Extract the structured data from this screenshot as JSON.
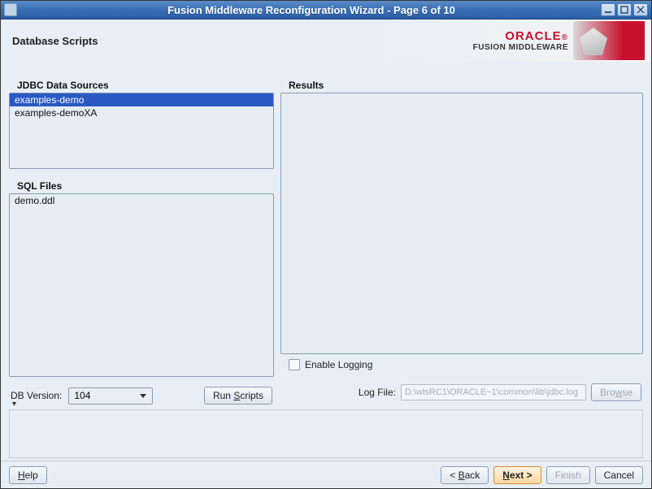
{
  "window": {
    "title": "Fusion Middleware Reconfiguration Wizard - Page 6 of 10"
  },
  "header": {
    "title": "Database Scripts",
    "brand_main": "ORACLE",
    "brand_sub": "FUSION MIDDLEWARE"
  },
  "left": {
    "ds_label": "JDBC Data Sources",
    "ds_items": [
      "examples-demo",
      "examples-demoXA"
    ],
    "ds_selected_index": 0,
    "sql_label": "SQL Files",
    "sql_items": [
      "demo.ddl"
    ],
    "db_version_label": "DB Version:",
    "db_version_value": "104",
    "run_scripts_label": "Run Scripts"
  },
  "right": {
    "results_label": "Results",
    "enable_logging_label": "Enable Logging",
    "enable_logging_checked": false,
    "log_file_label": "Log File:",
    "log_file_value": "D:\\wlsRC1\\ORACLE~1\\common\\lib\\jdbc.log",
    "browse_label": "Browse"
  },
  "footer": {
    "help": "Help",
    "back": "< Back",
    "next": "Next >",
    "finish": "Finish",
    "cancel": "Cancel"
  }
}
